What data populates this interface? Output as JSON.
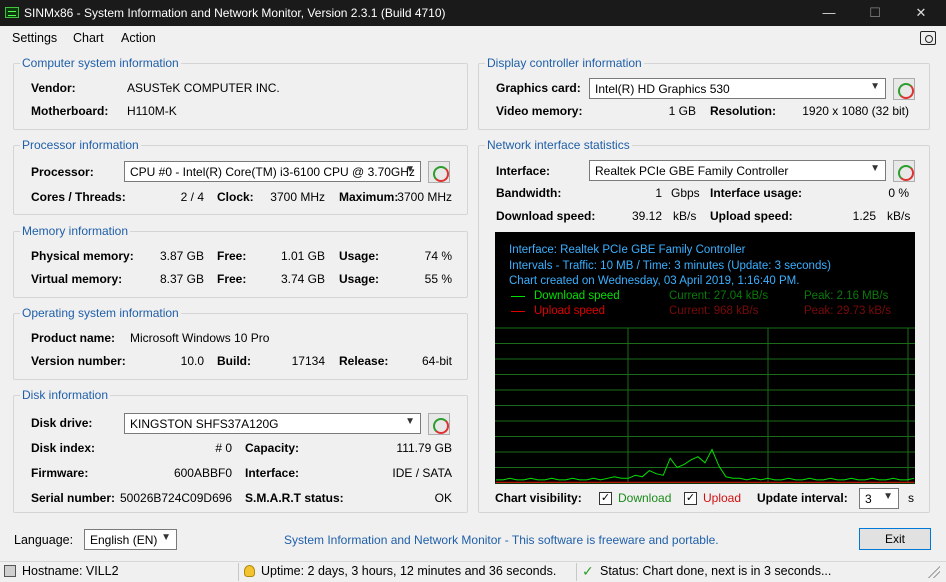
{
  "window": {
    "title": "SINMx86 - System Information and Network Monitor, Version 2.3.1 (Build 4710)",
    "minimize": "—",
    "maximize": "☐",
    "close": "✕"
  },
  "menu": {
    "settings": "Settings",
    "chart": "Chart",
    "action": "Action"
  },
  "computer": {
    "title": "Computer system information",
    "vendor_label": "Vendor:",
    "vendor": "ASUSTeK COMPUTER INC.",
    "motherboard_label": "Motherboard:",
    "motherboard": "H110M-K"
  },
  "processor": {
    "title": "Processor information",
    "processor_label": "Processor:",
    "processor": "CPU #0 - Intel(R) Core(TM) i3-6100 CPU @ 3.70GHz",
    "cores_label": "Cores / Threads:",
    "cores": "2 / 4",
    "clock_label": "Clock:",
    "clock": "3700 MHz",
    "max_label": "Maximum:",
    "max": "3700 MHz"
  },
  "memory": {
    "title": "Memory information",
    "phys_label": "Physical memory:",
    "phys": "3.87 GB",
    "phys_free_label": "Free:",
    "phys_free": "1.01 GB",
    "phys_usage_label": "Usage:",
    "phys_usage": "74 %",
    "virt_label": "Virtual memory:",
    "virt": "8.37 GB",
    "virt_free_label": "Free:",
    "virt_free": "3.74 GB",
    "virt_usage_label": "Usage:",
    "virt_usage": "55 %"
  },
  "os": {
    "title": "Operating system information",
    "product_label": "Product name:",
    "product": "Microsoft Windows 10 Pro",
    "version_label": "Version number:",
    "version": "10.0",
    "build_label": "Build:",
    "build": "17134",
    "release_label": "Release:",
    "release": "64-bit"
  },
  "disk": {
    "title": "Disk information",
    "drive_label": "Disk drive:",
    "drive": "KINGSTON SHFS37A120G",
    "index_label": "Disk index:",
    "index": "# 0",
    "capacity_label": "Capacity:",
    "capacity": "111.79 GB",
    "firmware_label": "Firmware:",
    "firmware": "600ABBF0",
    "interface_label": "Interface:",
    "interface": "IDE / SATA",
    "serial_label": "Serial number:",
    "serial": "50026B724C09D696",
    "smart_label": "S.M.A.R.T status:",
    "smart": "OK"
  },
  "display": {
    "title": "Display controller information",
    "card_label": "Graphics card:",
    "card": "Intel(R) HD Graphics 530",
    "vmem_label": "Video memory:",
    "vmem": "1 GB",
    "res_label": "Resolution:",
    "res": "1920 x 1080 (32 bit)"
  },
  "network": {
    "title": "Network interface statistics",
    "iface_label": "Interface:",
    "iface": "Realtek PCIe GBE Family Controller",
    "bw_label": "Bandwidth:",
    "bw": "1",
    "bw_unit": "Gbps",
    "usage_label": "Interface usage:",
    "usage": "0 %",
    "dl_label": "Download speed:",
    "dl": "39.12",
    "dl_unit": "kB/s",
    "ul_label": "Upload speed:",
    "ul": "1.25",
    "ul_unit": "kB/s"
  },
  "chart_info": {
    "line1": "Interface: Realtek PCIe GBE Family Controller",
    "line2": "Intervals - Traffic: 10 MB / Time: 3 minutes (Update: 3 seconds)",
    "line3": "Chart created on Wednesday, 03 April 2019, 1:16:40 PM.",
    "dl_legend": "Download speed",
    "dl_current": "Current: 27.04 kB/s",
    "dl_peak": "Peak: 2.16 MB/s",
    "ul_legend": "Upload speed",
    "ul_current": "Current: 968 kB/s",
    "ul_peak": "Peak: 29.73 kB/s"
  },
  "chart_data": {
    "type": "line",
    "series": [
      {
        "name": "Download speed",
        "color": "#00e000",
        "values": [
          0.2,
          0.2,
          0.3,
          0.2,
          0.2,
          0.3,
          0.2,
          0.2,
          0.3,
          0.2,
          0.2,
          0.3,
          0.2,
          0.2,
          0.3,
          0.2,
          0.3,
          0.4,
          0.3,
          0.3,
          0.5,
          0.4,
          0.8,
          0.6,
          0.5,
          1.6,
          1.0,
          1.2,
          1.5,
          1.7,
          1.3,
          2.16,
          1.1,
          0.4,
          0.3,
          0.3,
          0.2,
          0.3,
          0.2,
          0.3,
          0.2,
          0.2,
          0.3,
          0.2,
          0.2,
          0.3,
          0.2,
          0.2,
          0.3,
          0.2,
          0.2,
          0.3,
          0.2,
          0.2,
          0.3,
          0.2,
          0.2,
          0.3,
          0.2,
          0.2,
          0.3
        ]
      },
      {
        "name": "Upload speed",
        "color": "#e00000",
        "values": [
          0.05,
          0.05,
          0.05,
          0.05,
          0.05,
          0.05,
          0.05,
          0.05,
          0.05,
          0.05,
          0.05,
          0.05,
          0.05,
          0.05,
          0.05,
          0.05,
          0.05,
          0.05,
          0.05,
          0.05,
          0.05,
          0.05,
          0.05,
          0.05,
          0.05,
          0.05,
          0.05,
          0.05,
          0.05,
          0.05,
          0.05,
          0.05,
          0.05,
          0.05,
          0.05,
          0.05,
          0.05,
          0.05,
          0.05,
          0.05,
          0.05,
          0.05,
          0.05,
          0.05,
          0.05,
          0.05,
          0.05,
          0.05,
          0.05,
          0.05,
          0.05,
          0.05,
          0.05,
          0.05,
          0.05,
          0.05,
          0.05,
          0.05,
          0.05,
          0.05,
          0.05
        ]
      }
    ],
    "ylim": [
      0,
      10
    ],
    "grid": true
  },
  "controls": {
    "visibility_label": "Chart visibility:",
    "download": "Download",
    "upload": "Upload",
    "check": "✓",
    "interval_label": "Update interval:",
    "interval": "3",
    "interval_unit": "s"
  },
  "footer": {
    "language_label": "Language:",
    "language": "English (EN)",
    "info": "System Information and Network Monitor - This software is freeware and portable.",
    "exit": "Exit"
  },
  "status": {
    "hostname": "Hostname: VILL2",
    "uptime": "Uptime: 2 days, 3 hours, 12 minutes and 36 seconds.",
    "status": "Status: Chart done, next is in 3 seconds..."
  },
  "colors": {
    "accent": "#1f5fa8",
    "chart_grid": "#1a6b1a",
    "dl": "#00e000",
    "ul": "#e00000"
  }
}
